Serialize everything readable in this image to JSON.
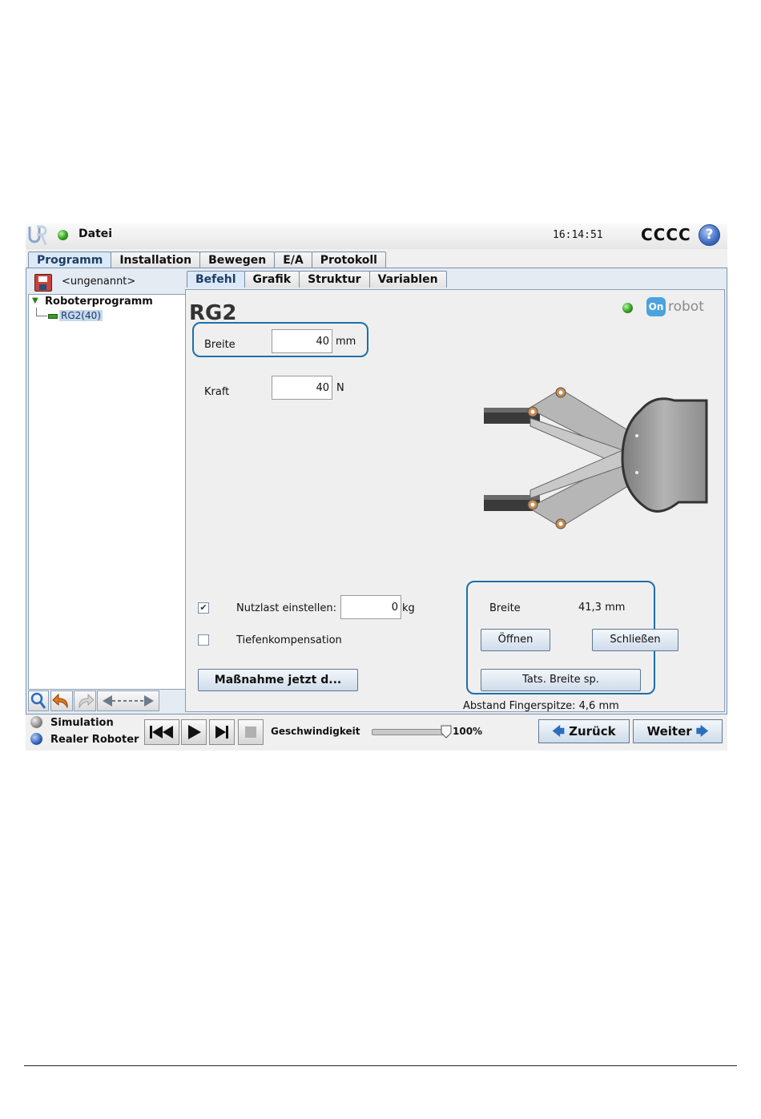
{
  "titlebar": {
    "menu_label": "Datei",
    "clock": "16:14:51",
    "robot_name": "CCCC",
    "help_symbol": "?"
  },
  "main_tabs": [
    {
      "label": "Programm",
      "active": true
    },
    {
      "label": "Installation",
      "active": false
    },
    {
      "label": "Bewegen",
      "active": false
    },
    {
      "label": "E/A",
      "active": false
    },
    {
      "label": "Protokoll",
      "active": false
    }
  ],
  "left": {
    "program_name": "<ungenannt>",
    "tree_root": "Roboterprogramm",
    "tree_child": "RG2(40)"
  },
  "sub_tabs": [
    {
      "label": "Befehl",
      "active": true
    },
    {
      "label": "Grafik",
      "active": false
    },
    {
      "label": "Struktur",
      "active": false
    },
    {
      "label": "Variablen",
      "active": false
    }
  ],
  "command": {
    "title": "RG2",
    "brand_logo_text": "robot",
    "brand_logo_mark": "On",
    "width_label": "Breite",
    "width_value": "40",
    "width_unit": "mm",
    "force_label": "Kraft",
    "force_value": "40",
    "force_unit": "N",
    "payload_checked": true,
    "payload_label": "Nutzlast einstellen:",
    "payload_value": "0",
    "payload_unit": "kg",
    "depth_checked": false,
    "depth_label": "Tiefenkompensation",
    "measure_button": "Maßnahme jetzt d...",
    "live_width_label": "Breite",
    "live_width_value": "41,3 mm",
    "open_button": "Öffnen",
    "close_button": "Schließen",
    "use_width_button": "Tats. Breite sp.",
    "fingertip_distance": "Abstand Fingerspitze: 4,6 mm"
  },
  "bottom": {
    "simulation_label": "Simulation",
    "real_robot_label": "Realer Roboter",
    "mode_selected": "Realer Roboter",
    "speed_label": "Geschwindigkeit",
    "speed_value": "100%",
    "speed_fraction": 1.0,
    "back_button": "Zurück",
    "next_button": "Weiter"
  },
  "colors": {
    "highlight_box": "#1f6fa8",
    "active_tab": "#dbe9f8",
    "status_green": "#2e9e1f",
    "onrobot_blue": "#4aa3df"
  }
}
